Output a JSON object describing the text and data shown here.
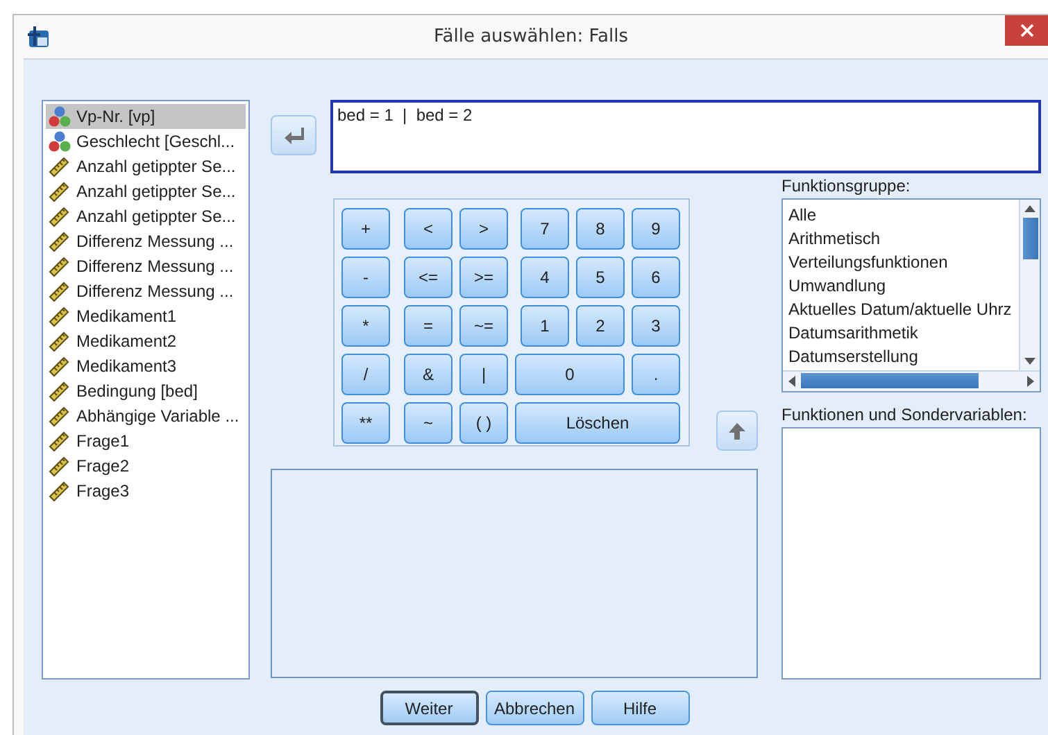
{
  "window": {
    "title": "Fälle auswählen: Falls"
  },
  "variables": [
    {
      "label": "Vp-Nr. [vp]",
      "kind": "nominal",
      "selected": true
    },
    {
      "label": "Geschlecht [Geschl...",
      "kind": "nominal",
      "selected": false
    },
    {
      "label": "Anzahl getippter Se...",
      "kind": "scale",
      "selected": false
    },
    {
      "label": "Anzahl getippter Se...",
      "kind": "scale",
      "selected": false
    },
    {
      "label": "Anzahl getippter Se...",
      "kind": "scale",
      "selected": false
    },
    {
      "label": "Differenz Messung ...",
      "kind": "scale",
      "selected": false
    },
    {
      "label": "Differenz Messung ...",
      "kind": "scale",
      "selected": false
    },
    {
      "label": "Differenz Messung ...",
      "kind": "scale",
      "selected": false
    },
    {
      "label": "Medikament1",
      "kind": "scale",
      "selected": false
    },
    {
      "label": "Medikament2",
      "kind": "scale",
      "selected": false
    },
    {
      "label": "Medikament3",
      "kind": "scale",
      "selected": false
    },
    {
      "label": "Bedingung [bed]",
      "kind": "scale",
      "selected": false
    },
    {
      "label": "Abhängige Variable ...",
      "kind": "scale",
      "selected": false
    },
    {
      "label": "Frage1",
      "kind": "scale",
      "selected": false
    },
    {
      "label": "Frage2",
      "kind": "scale",
      "selected": false
    },
    {
      "label": "Frage3",
      "kind": "scale",
      "selected": false
    }
  ],
  "expression": {
    "value": "bed = 1  |  bed = 2"
  },
  "keypad": [
    [
      "+",
      "<",
      ">",
      "7",
      "8",
      "9"
    ],
    [
      "-",
      "<=",
      ">=",
      "4",
      "5",
      "6"
    ],
    [
      "*",
      "=",
      "~=",
      "1",
      "2",
      "3"
    ],
    [
      "/",
      "&",
      "|",
      "0",
      "."
    ],
    [
      "**",
      "~",
      "( )",
      "Löschen"
    ]
  ],
  "function_group": {
    "label": "Funktionsgruppe:",
    "items": [
      "Alle",
      "Arithmetisch",
      "Verteilungsfunktionen",
      "Umwandlung",
      "Aktuelles Datum/aktuelle Uhrz",
      "Datumsarithmetik",
      "Datumserstellung"
    ]
  },
  "functions": {
    "label": "Funktionen und Sondervariablen:"
  },
  "buttons": [
    "Weiter",
    "Abbrechen",
    "Hilfe"
  ]
}
